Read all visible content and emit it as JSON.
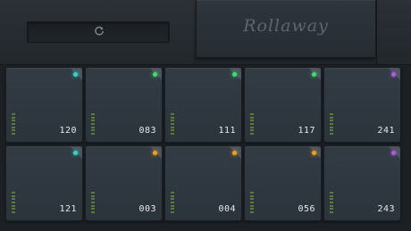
{
  "header": {
    "title": "Rollaway",
    "refresh_icon": "refresh-icon"
  },
  "pads": [
    {
      "label": "120",
      "led_color": "#33d6c8"
    },
    {
      "label": "083",
      "led_color": "#3ee06a"
    },
    {
      "label": "111",
      "led_color": "#3ee06a"
    },
    {
      "label": "117",
      "led_color": "#3ee06a"
    },
    {
      "label": "241",
      "led_color": "#b05ae0"
    },
    {
      "label": "121",
      "led_color": "#33d6c8"
    },
    {
      "label": "003",
      "led_color": "#f0a020"
    },
    {
      "label": "004",
      "led_color": "#f0a020"
    },
    {
      "label": "056",
      "led_color": "#f0a020"
    },
    {
      "label": "243",
      "led_color": "#b05ae0"
    }
  ]
}
